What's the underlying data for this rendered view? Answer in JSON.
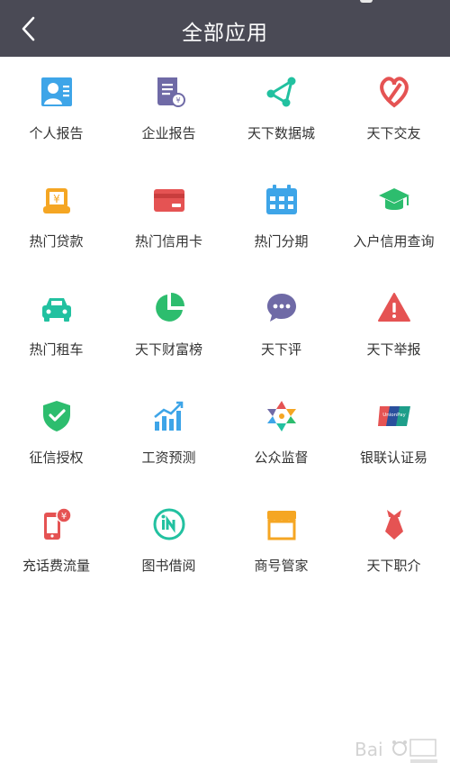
{
  "header": {
    "title": "全部应用"
  },
  "apps": [
    {
      "label": "个人报告"
    },
    {
      "label": "企业报告"
    },
    {
      "label": "天下数据城"
    },
    {
      "label": "天下交友"
    },
    {
      "label": "热门贷款"
    },
    {
      "label": "热门信用卡"
    },
    {
      "label": "热门分期"
    },
    {
      "label": "入户信用查询"
    },
    {
      "label": "热门租车"
    },
    {
      "label": "天下财富榜"
    },
    {
      "label": "天下评"
    },
    {
      "label": "天下举报"
    },
    {
      "label": "征信授权"
    },
    {
      "label": "工资预测"
    },
    {
      "label": "公众监督"
    },
    {
      "label": "银联认证易"
    },
    {
      "label": "充话费流量"
    },
    {
      "label": "图书借阅"
    },
    {
      "label": "商号管家"
    },
    {
      "label": "天下职介"
    }
  ],
  "colors": {
    "header_bg": "#4a4a55",
    "blue": "#3ea5e8",
    "purple": "#6f6aa6",
    "teal": "#22c1a0",
    "red": "#e55353",
    "orange": "#f5a623",
    "green": "#2dbd6e"
  }
}
